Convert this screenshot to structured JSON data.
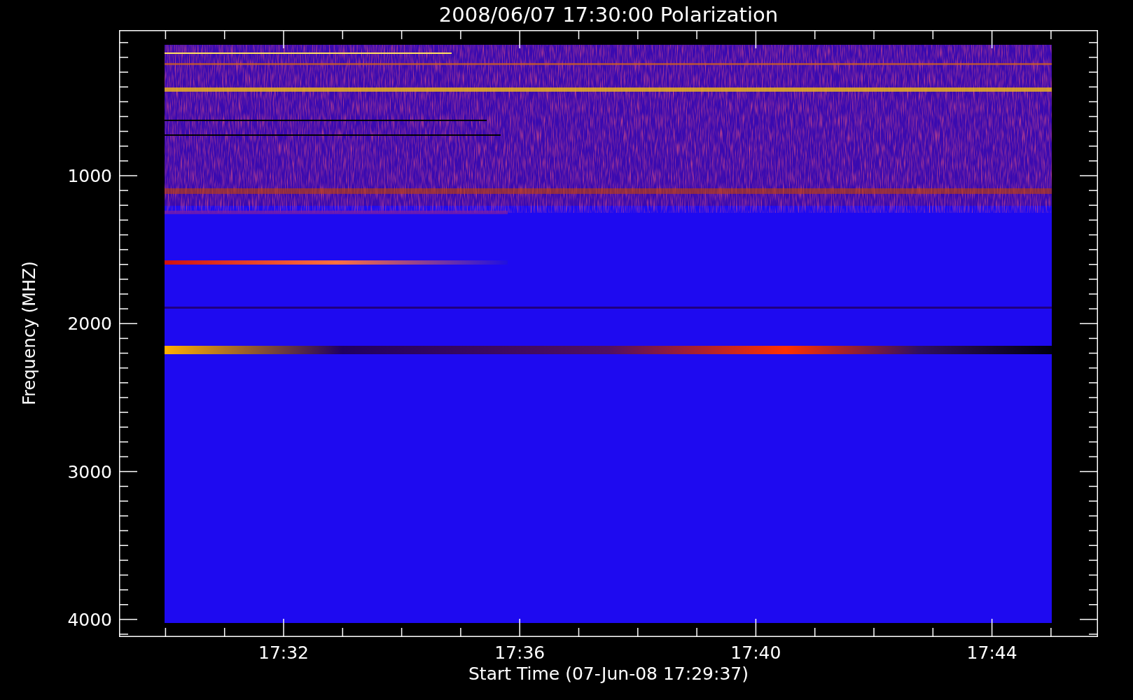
{
  "plot": {
    "title": "2008/06/07 17:30:00 Polarization",
    "ylabel": "Frequency (MHZ)",
    "xlabel": "Start Time (07-Jun-08 17:29:37)",
    "yticks": [
      "1000",
      "2000",
      "3000",
      "4000"
    ],
    "xticks": [
      "17:32",
      "17:36",
      "17:40",
      "17:44"
    ]
  }
}
